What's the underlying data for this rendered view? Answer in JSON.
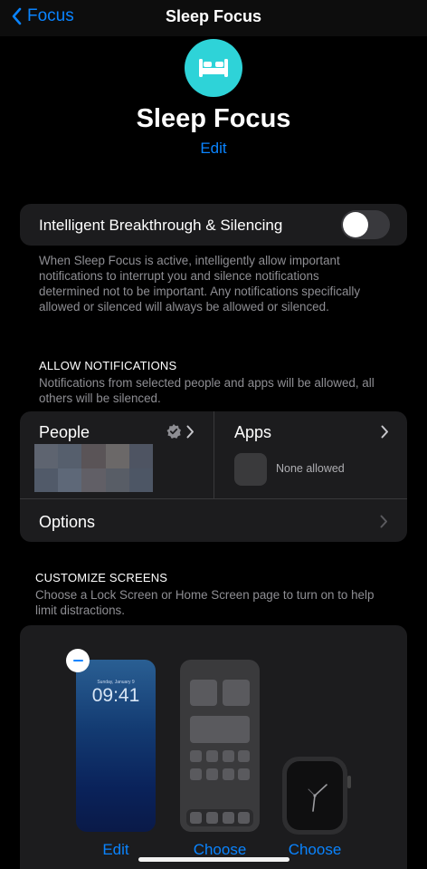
{
  "nav": {
    "back_label": "Focus",
    "title": "Sleep Focus"
  },
  "header": {
    "title": "Sleep Focus",
    "edit_label": "Edit",
    "icon": "bed-icon",
    "icon_color": "#2ED3D8"
  },
  "intelligent_breakthrough": {
    "label": "Intelligent Breakthrough & Silencing",
    "enabled": false,
    "footnote": "When Sleep Focus is active, intelligently allow important notifications to interrupt you and silence notifications determined not to be important. Any notifications specifically allowed or silenced will always be allowed or silenced."
  },
  "allow_notifications": {
    "header": "ALLOW NOTIFICATIONS",
    "footnote": "Notifications from selected people and apps will be allowed, all others will be silenced.",
    "people_label": "People",
    "apps_label": "Apps",
    "apps_status": "None allowed",
    "options_label": "Options"
  },
  "customize_screens": {
    "header": "CUSTOMIZE SCREENS",
    "footnote": "Choose a Lock Screen or Home Screen page to turn on to help limit distractions.",
    "lock_screen": {
      "date": "Sunday, January 9",
      "time": "09:41",
      "action_label": "Edit"
    },
    "home_screen": {
      "action_label": "Choose"
    },
    "watch_face": {
      "action_label": "Choose"
    }
  },
  "colors": {
    "accent": "#0A84FF",
    "background": "#000000",
    "card": "#1C1C1E"
  }
}
